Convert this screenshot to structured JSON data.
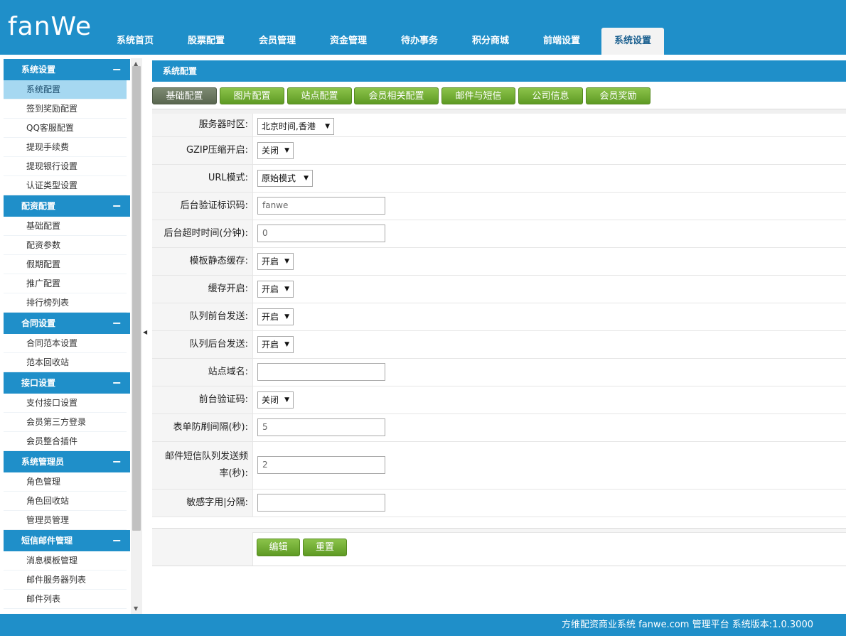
{
  "app": {
    "logo": "fanWe"
  },
  "nav": {
    "tabs": [
      "系统首页",
      "股票配置",
      "会员管理",
      "资金管理",
      "待办事务",
      "积分商城",
      "前端设置",
      "系统设置"
    ],
    "active": "系统设置"
  },
  "sidebar": {
    "groups": [
      {
        "title": "系统设置",
        "items": [
          "系统配置",
          "签到奖励配置",
          "QQ客服配置",
          "提现手续费",
          "提现银行设置",
          "认证类型设置"
        ]
      },
      {
        "title": "配资配置",
        "items": [
          "基础配置",
          "配资参数",
          "假期配置",
          "推广配置",
          "排行榜列表"
        ]
      },
      {
        "title": "合同设置",
        "items": [
          "合同范本设置",
          "范本回收站"
        ]
      },
      {
        "title": "接口设置",
        "items": [
          "支付接口设置",
          "会员第三方登录",
          "会员整合插件"
        ]
      },
      {
        "title": "系统管理员",
        "items": [
          "角色管理",
          "角色回收站",
          "管理员管理"
        ]
      },
      {
        "title": "短信邮件管理",
        "items": [
          "消息模板管理",
          "邮件服务器列表",
          "邮件列表"
        ]
      }
    ],
    "collapse_symbol": "−",
    "active_item": "系统配置"
  },
  "panel": {
    "title": "系统配置"
  },
  "subtabs": {
    "items": [
      "基础配置",
      "图片配置",
      "站点配置",
      "会员相关配置",
      "邮件与短信",
      "公司信息",
      "会员奖励"
    ],
    "active": "基础配置"
  },
  "form": {
    "fields": [
      {
        "label": "服务器时区:",
        "type": "select",
        "value": "北京时间,香港"
      },
      {
        "label": "GZIP压缩开启:",
        "type": "select",
        "value": "关闭"
      },
      {
        "label": "URL模式:",
        "type": "select",
        "value": "原始模式"
      },
      {
        "label": "后台验证标识码:",
        "type": "input",
        "value": "fanwe"
      },
      {
        "label": "后台超时时间(分钟):",
        "type": "input",
        "value": "0"
      },
      {
        "label": "模板静态缓存:",
        "type": "select",
        "value": "开启"
      },
      {
        "label": "缓存开启:",
        "type": "select",
        "value": "开启"
      },
      {
        "label": "队列前台发送:",
        "type": "select",
        "value": "开启"
      },
      {
        "label": "队列后台发送:",
        "type": "select",
        "value": "开启"
      },
      {
        "label": "站点域名:",
        "type": "input",
        "value": ""
      },
      {
        "label": "前台验证码:",
        "type": "select",
        "value": "关闭"
      },
      {
        "label": "表单防刷间隔(秒):",
        "type": "input",
        "value": "5"
      },
      {
        "label": "邮件短信队列发送频率(秒):",
        "type": "input",
        "value": "2"
      },
      {
        "label": "敏感字用|分隔:",
        "type": "input",
        "value": ""
      }
    ],
    "edit_label": "编辑",
    "reset_label": "重置"
  },
  "footer": {
    "text": "方维配资商业系统 fanwe.com 管理平台 系统版本:1.0.3000"
  },
  "colors": {
    "primary": "#1f8fc9",
    "green": "#6aa52e",
    "active_tab": "#6b7661",
    "menu_active": "#a6d8f1"
  }
}
